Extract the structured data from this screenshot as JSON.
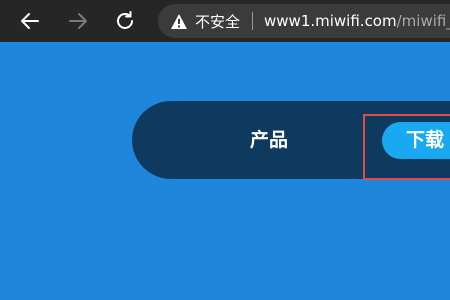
{
  "browser": {
    "security_label": "不安全",
    "url_host": "www1.miwifi.com",
    "url_path": "/miwifi_do",
    "icons": {
      "back": "back-arrow-icon",
      "forward": "forward-arrow-icon",
      "reload": "reload-icon",
      "warning": "warning-triangle-icon"
    }
  },
  "site_nav": {
    "products_label": "产品",
    "download_label": "下载"
  },
  "colors": {
    "page_background": "#1e87dc",
    "nav_background": "#0e3a60",
    "download_button": "#19a9f0",
    "highlight_border": "#e04a4a",
    "toolbar_background": "#262626"
  }
}
